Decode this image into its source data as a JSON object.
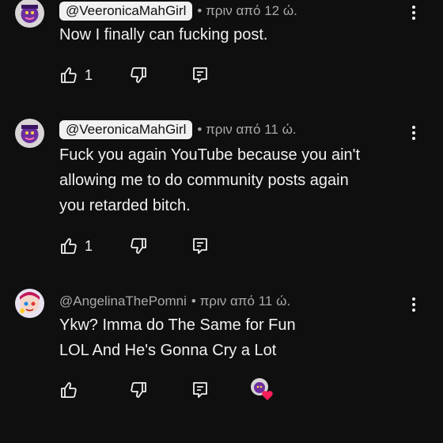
{
  "comments": [
    {
      "author": "@VeeronicaMahGirl",
      "author_highlighted": true,
      "time": "• πριν από 12 ώ.",
      "lines": [
        "Now I finally can fucking post."
      ],
      "likes": "1",
      "hearted": false
    },
    {
      "author": "@VeeronicaMahGirl",
      "author_highlighted": true,
      "time": "• πριν από 11 ώ.",
      "lines": [
        "Fuck you again YouTube because you ain't",
        "allowing me to do community posts again",
        "you retarded bitch."
      ],
      "likes": "1",
      "hearted": false
    },
    {
      "author": "@AngelinaThePomni",
      "author_highlighted": false,
      "time": "• πριν από 11 ώ.",
      "lines": [
        "Ykw? Imma do The Same for Fun",
        "LOL And He's Gonna Cry a Lot"
      ],
      "likes": "",
      "hearted": true
    }
  ],
  "icons": {
    "like": "thumbs-up-icon",
    "dislike": "thumbs-down-icon",
    "reply": "reply-icon",
    "menu": "more-vertical-icon",
    "heart": "creator-heart-icon"
  },
  "colors": {
    "background": "#0f0f0f",
    "text": "#f1f1f1",
    "muted": "#aaaaaa",
    "heart": "#ff1f5a",
    "avatar_purple": "#6b2fa0"
  }
}
